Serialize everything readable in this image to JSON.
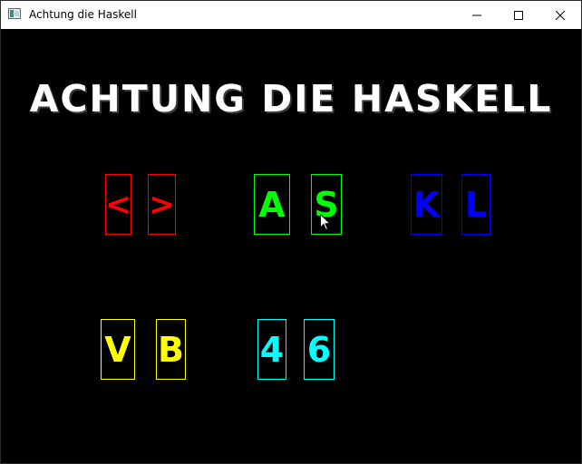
{
  "window": {
    "title": "Achtung die Haskell"
  },
  "game": {
    "title": "ACHTUNG DIE HASKELL",
    "players": [
      {
        "color": "#ff0000",
        "left_key": "<",
        "right_key": ">"
      },
      {
        "color": "#00ff00",
        "left_key": "A",
        "right_key": "S"
      },
      {
        "color": "#0000ff",
        "left_key": "K",
        "right_key": "L"
      },
      {
        "color": "#ffff00",
        "left_key": "V",
        "right_key": "B"
      },
      {
        "color": "#00ffff",
        "left_key": "4",
        "right_key": "6"
      }
    ]
  },
  "icons": {
    "app": "app-window-icon",
    "minimize": "minimize-icon",
    "maximize": "maximize-icon",
    "close": "close-icon",
    "cursor": "mouse-pointer-icon"
  }
}
